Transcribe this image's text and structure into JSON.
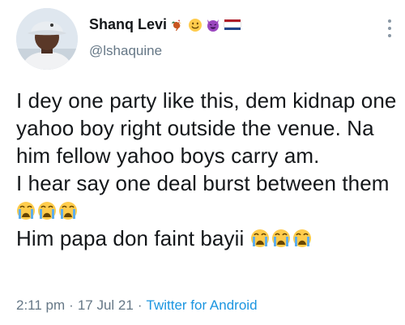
{
  "author": {
    "display_name": "Shanq Levi",
    "name_emojis": [
      "rooster-emoji",
      "smiling-face-emoji",
      "smiling-devil-emoji",
      "netherlands-flag-emoji"
    ],
    "handle": "@lshaquine",
    "avatar": "profile-photo"
  },
  "tweet": {
    "paragraph_1": "I dey one party like this, dem kidnap one yahoo boy right outside the venue. Na him fellow yahoo boys carry am.",
    "paragraph_2": "I hear say one deal burst between them",
    "paragraph_3": "Him papa don faint bayii",
    "emoji_icon": "loudly-crying-face-emoji"
  },
  "meta": {
    "time": "2:11 pm",
    "date": "17 Jul 21",
    "source": "Twitter for Android",
    "separator": "·"
  },
  "colors": {
    "text": "#14171a",
    "secondary": "#657786",
    "link": "#1b95e0",
    "emoji_yellow": "#ffcc4d",
    "tear_blue": "#5dadec"
  }
}
